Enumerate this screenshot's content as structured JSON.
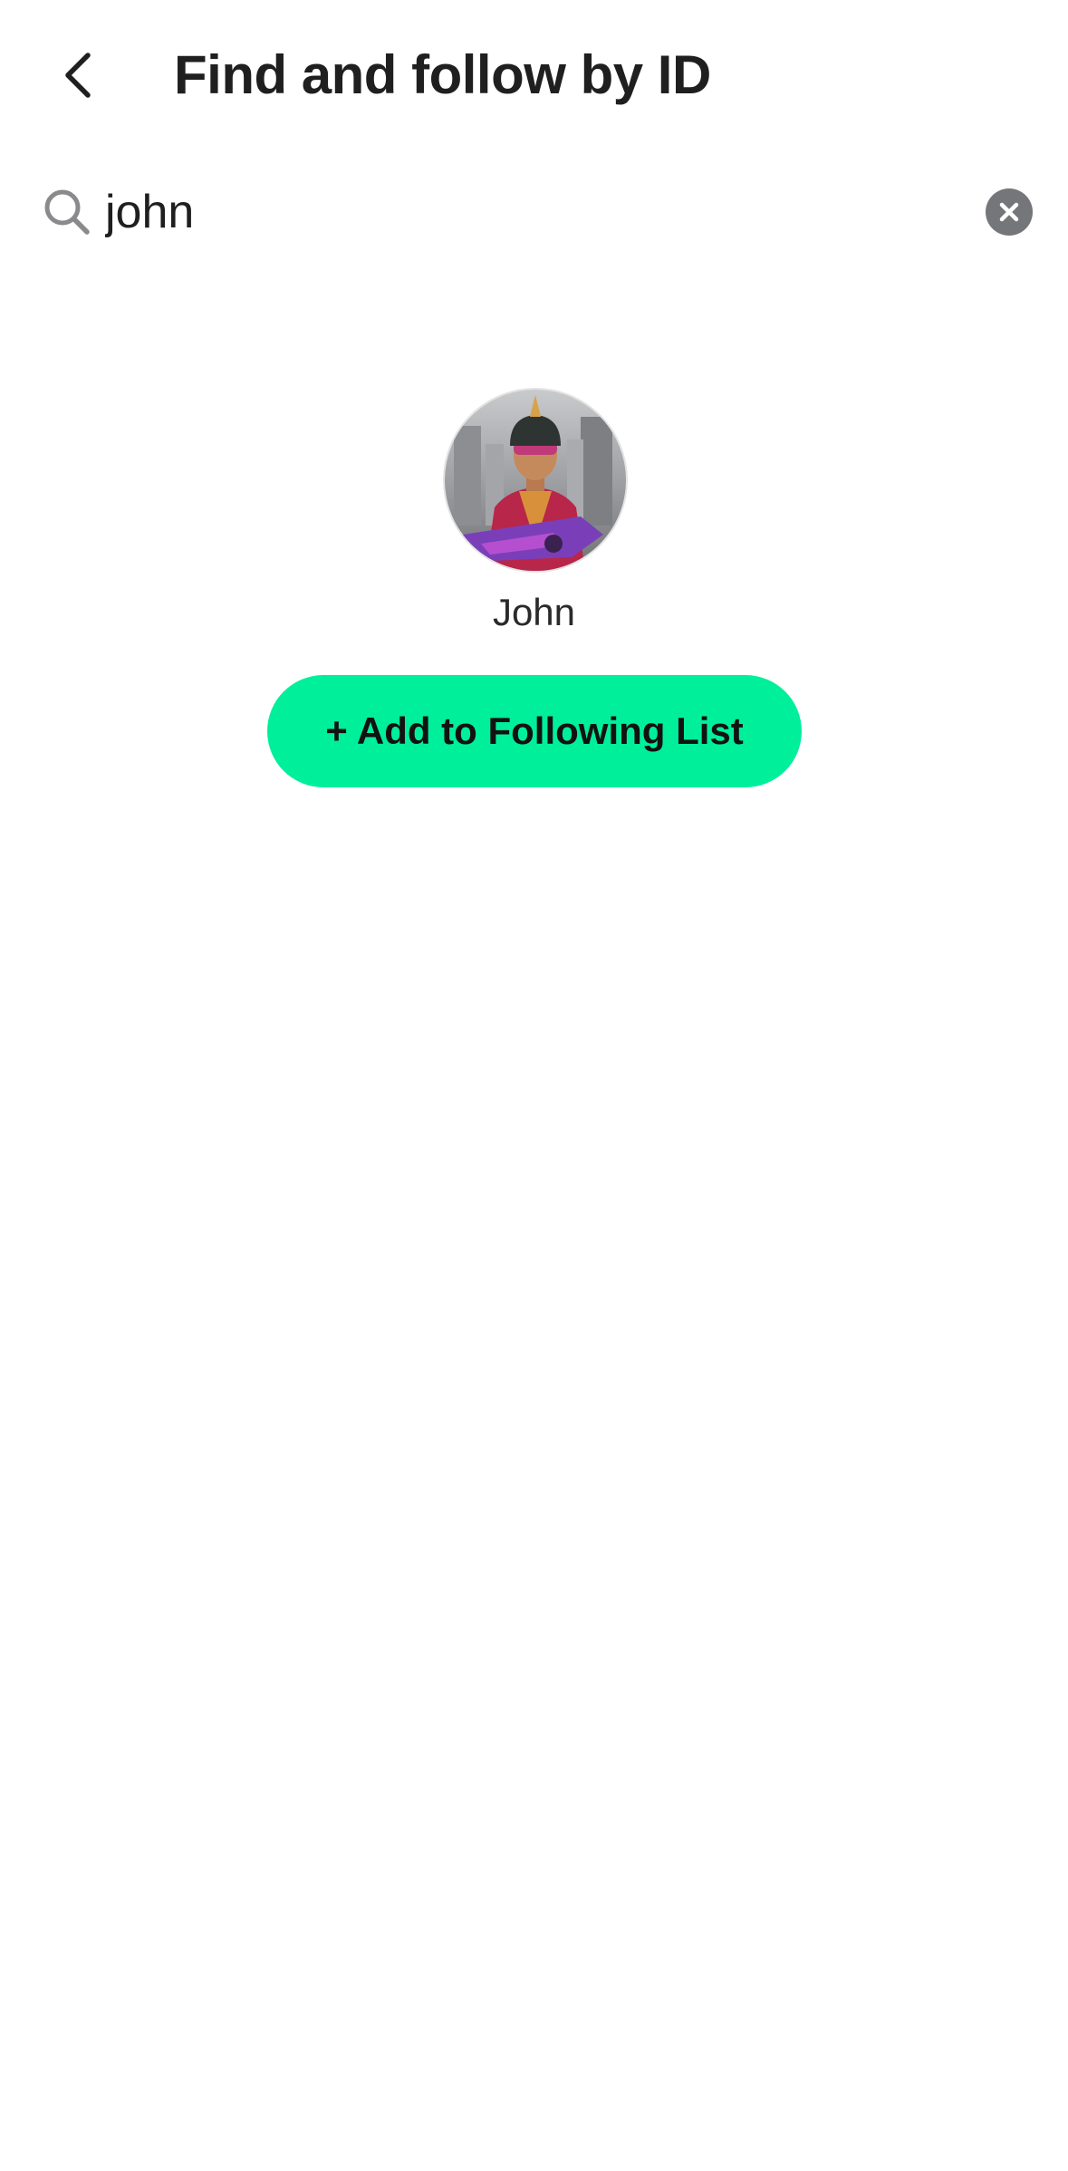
{
  "header": {
    "back_icon": "chevron-left-icon",
    "title": "Find and follow by ID"
  },
  "search": {
    "icon": "search-icon",
    "value": "john",
    "clear_icon": "close-circle-icon",
    "clear_color": "#75767a"
  },
  "result": {
    "avatar_description": "user-avatar",
    "name": "John",
    "add_button_label": "+ Add to Following List",
    "add_button_color": "#00ef9b"
  }
}
